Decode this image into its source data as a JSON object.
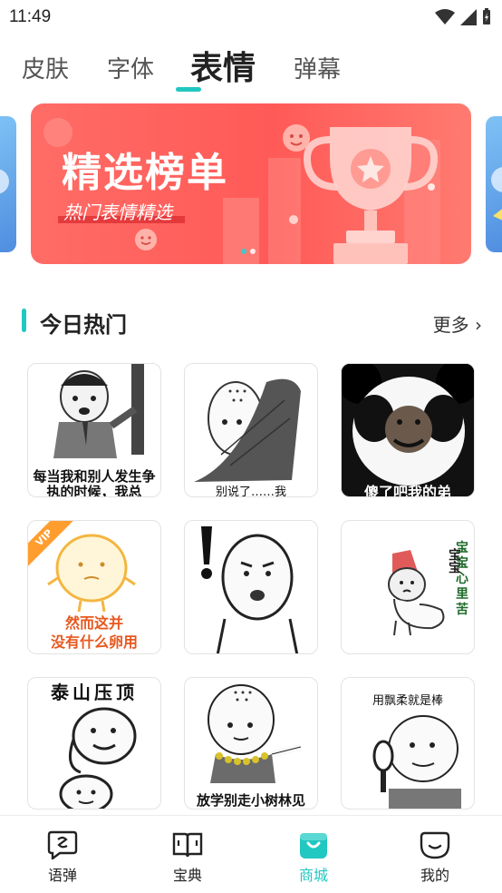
{
  "status": {
    "time": "11:49"
  },
  "tabs": [
    {
      "label": "皮肤"
    },
    {
      "label": "字体"
    },
    {
      "label": "表情"
    },
    {
      "label": "弹幕"
    }
  ],
  "banner": {
    "title": "精选榜单",
    "subtitle": "热门表情精选",
    "page_count": 2,
    "active_page": 1
  },
  "section": {
    "title": "今日热门",
    "more": "更多 ›"
  },
  "stickers": [
    {
      "caption": "每当我和别人发生争执的时候，我总",
      "vip": false
    },
    {
      "caption": "别说了……我",
      "vip": false
    },
    {
      "caption": "傻了吧我的弟",
      "vip": false
    },
    {
      "caption": "然而这并\n没有什么卵用",
      "vip": true,
      "vip_label": "VIP"
    },
    {
      "caption": "",
      "vip": false
    },
    {
      "caption": "",
      "vip": false,
      "side_text": "宝宝心里苦"
    },
    {
      "caption": "泰山压顶",
      "vip": false
    },
    {
      "caption": "放学别走小树林见",
      "vip": false
    },
    {
      "caption": "用飘柔就是棒",
      "vip": false
    }
  ],
  "bottom_nav": [
    {
      "label": "语弹",
      "icon": "chat-bubble-icon",
      "active": false
    },
    {
      "label": "宝典",
      "icon": "book-icon",
      "active": false
    },
    {
      "label": "商城",
      "icon": "shop-bag-icon",
      "active": true
    },
    {
      "label": "我的",
      "icon": "smile-face-icon",
      "active": false
    }
  ],
  "colors": {
    "accent": "#21c7c1",
    "banner": "#ff5a57",
    "vip": "#ff9d2e"
  }
}
